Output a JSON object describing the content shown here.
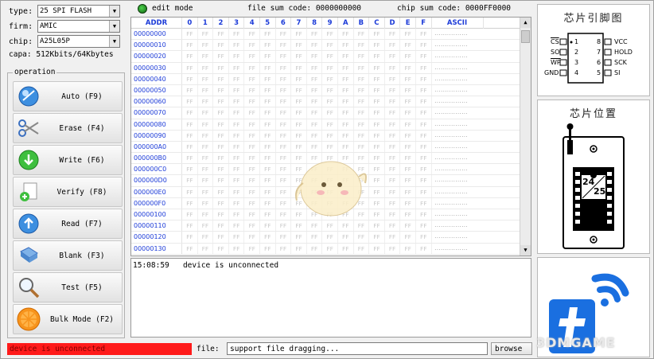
{
  "config": {
    "type_label": "type:",
    "type_value": "25 SPI FLASH",
    "firm_label": "firm:",
    "firm_value": "AMIC",
    "chip_label": "chip:",
    "chip_value": "A25L05P",
    "capa_label": "capa:",
    "capa_value": "512Kbits/64Kbytes"
  },
  "operation": {
    "title": "operation",
    "buttons": [
      {
        "label": "Auto (F9)",
        "icon": "auto-icon"
      },
      {
        "label": "Erase (F4)",
        "icon": "scissors-icon"
      },
      {
        "label": "Write (F6)",
        "icon": "download-icon"
      },
      {
        "label": "Verify (F8)",
        "icon": "verify-icon"
      },
      {
        "label": "Read (F7)",
        "icon": "upload-icon"
      },
      {
        "label": "Blank (F3)",
        "icon": "blank-icon"
      },
      {
        "label": "Test (F5)",
        "icon": "magnifier-icon"
      },
      {
        "label": "Bulk Mode (F2)",
        "icon": "orange-icon"
      }
    ]
  },
  "status": {
    "left_text": "device is unconnected"
  },
  "topbar": {
    "edit_mode": "edit mode",
    "file_sum_label": "file sum code:",
    "file_sum_value": "0000000000",
    "chip_sum_label": "chip sum code:",
    "chip_sum_value": "0000FF0000"
  },
  "hex": {
    "addr_header": "ADDR",
    "byte_headers": [
      "0",
      "1",
      "2",
      "3",
      "4",
      "5",
      "6",
      "7",
      "8",
      "9",
      "A",
      "B",
      "C",
      "D",
      "E",
      "F"
    ],
    "ascii_header": "ASCII",
    "byte_value": "FF",
    "ascii_value": "................",
    "addresses": [
      "00000000",
      "00000010",
      "00000020",
      "00000030",
      "00000040",
      "00000050",
      "00000060",
      "00000070",
      "00000080",
      "00000090",
      "000000A0",
      "000000B0",
      "000000C0",
      "000000D0",
      "000000E0",
      "000000F0",
      "00000100",
      "00000110",
      "00000120",
      "00000130"
    ]
  },
  "log": {
    "time": "15:08:59",
    "message": "device is unconnected"
  },
  "file": {
    "label": "file:",
    "value": "support file dragging...",
    "browse_label": "browse"
  },
  "right": {
    "pin_title": "芯片引脚图",
    "position_title": "芯片位置",
    "chip_label_top": "24",
    "chip_label_bottom": "25",
    "pins_left": [
      "CS",
      "SO",
      "WP",
      "GND"
    ],
    "pins_right": [
      "VCC",
      "HOLD",
      "SCK",
      "SI"
    ],
    "pin_numbers_left": [
      "1",
      "2",
      "3",
      "4"
    ],
    "pin_numbers_right": [
      "8",
      "7",
      "6",
      "5"
    ]
  },
  "watermark": "3DMGAME",
  "colors": {
    "status_error": "#ff1a1a",
    "addr_blue": "#1c3bd8",
    "logo_blue": "#1a6fe0"
  }
}
